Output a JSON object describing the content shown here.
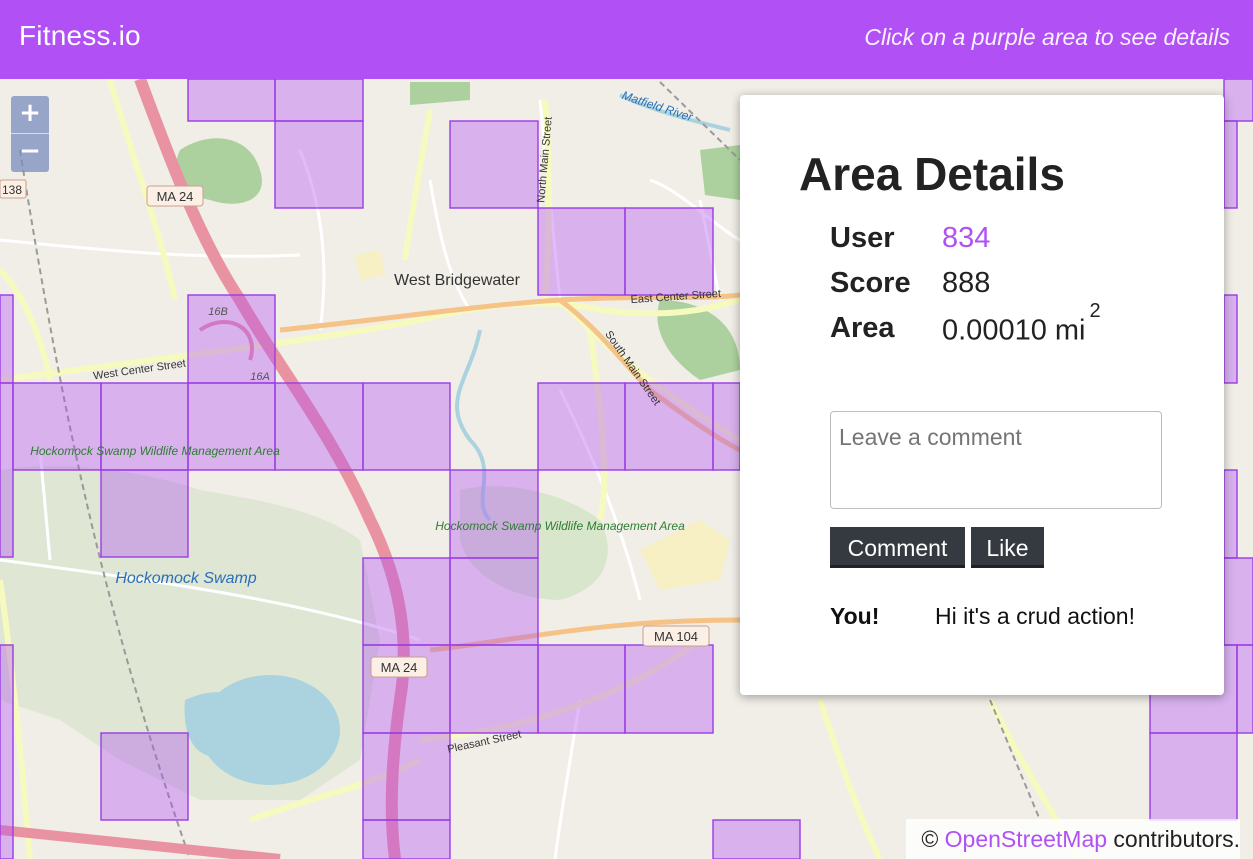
{
  "header": {
    "brand": "Fitness.io",
    "hint": "Click on a purple area to see details"
  },
  "map": {
    "zoom_in": "+",
    "zoom_out": "−",
    "labels": {
      "town": "West Bridgewater",
      "swamp": "Hockomock Swamp",
      "wma_left": "Hockomock Swamp Wildlife Management Area",
      "wma_right": "Hockomock Swamp Wildlife Management Area",
      "west_center": "West Center Street",
      "east_center": "East Center Street",
      "south_main": "South Main Street",
      "north_main": "North Main Street",
      "ma24": "MA 24",
      "ma104": "MA 104",
      "pleasant": "Pleasant Street",
      "matfield": "Matfield River",
      "exit16b": "16B",
      "exit16a": "16A",
      "route138": "138"
    },
    "attribution": {
      "prefix": "© ",
      "link": "OpenStreetMap",
      "suffix": " contributors."
    },
    "area_fill": "#b050f5"
  },
  "panel": {
    "title": "Area Details",
    "user_label": "User",
    "user_value": "834",
    "score_label": "Score",
    "score_value": "888",
    "area_label": "Area",
    "area_value": "0.00010 mi",
    "area_exp": "2",
    "comment_placeholder": "Leave a comment",
    "comment_button": "Comment",
    "like_button": "Like",
    "comments": [
      {
        "author": "You!",
        "text": "Hi it's a crud action!"
      }
    ]
  }
}
